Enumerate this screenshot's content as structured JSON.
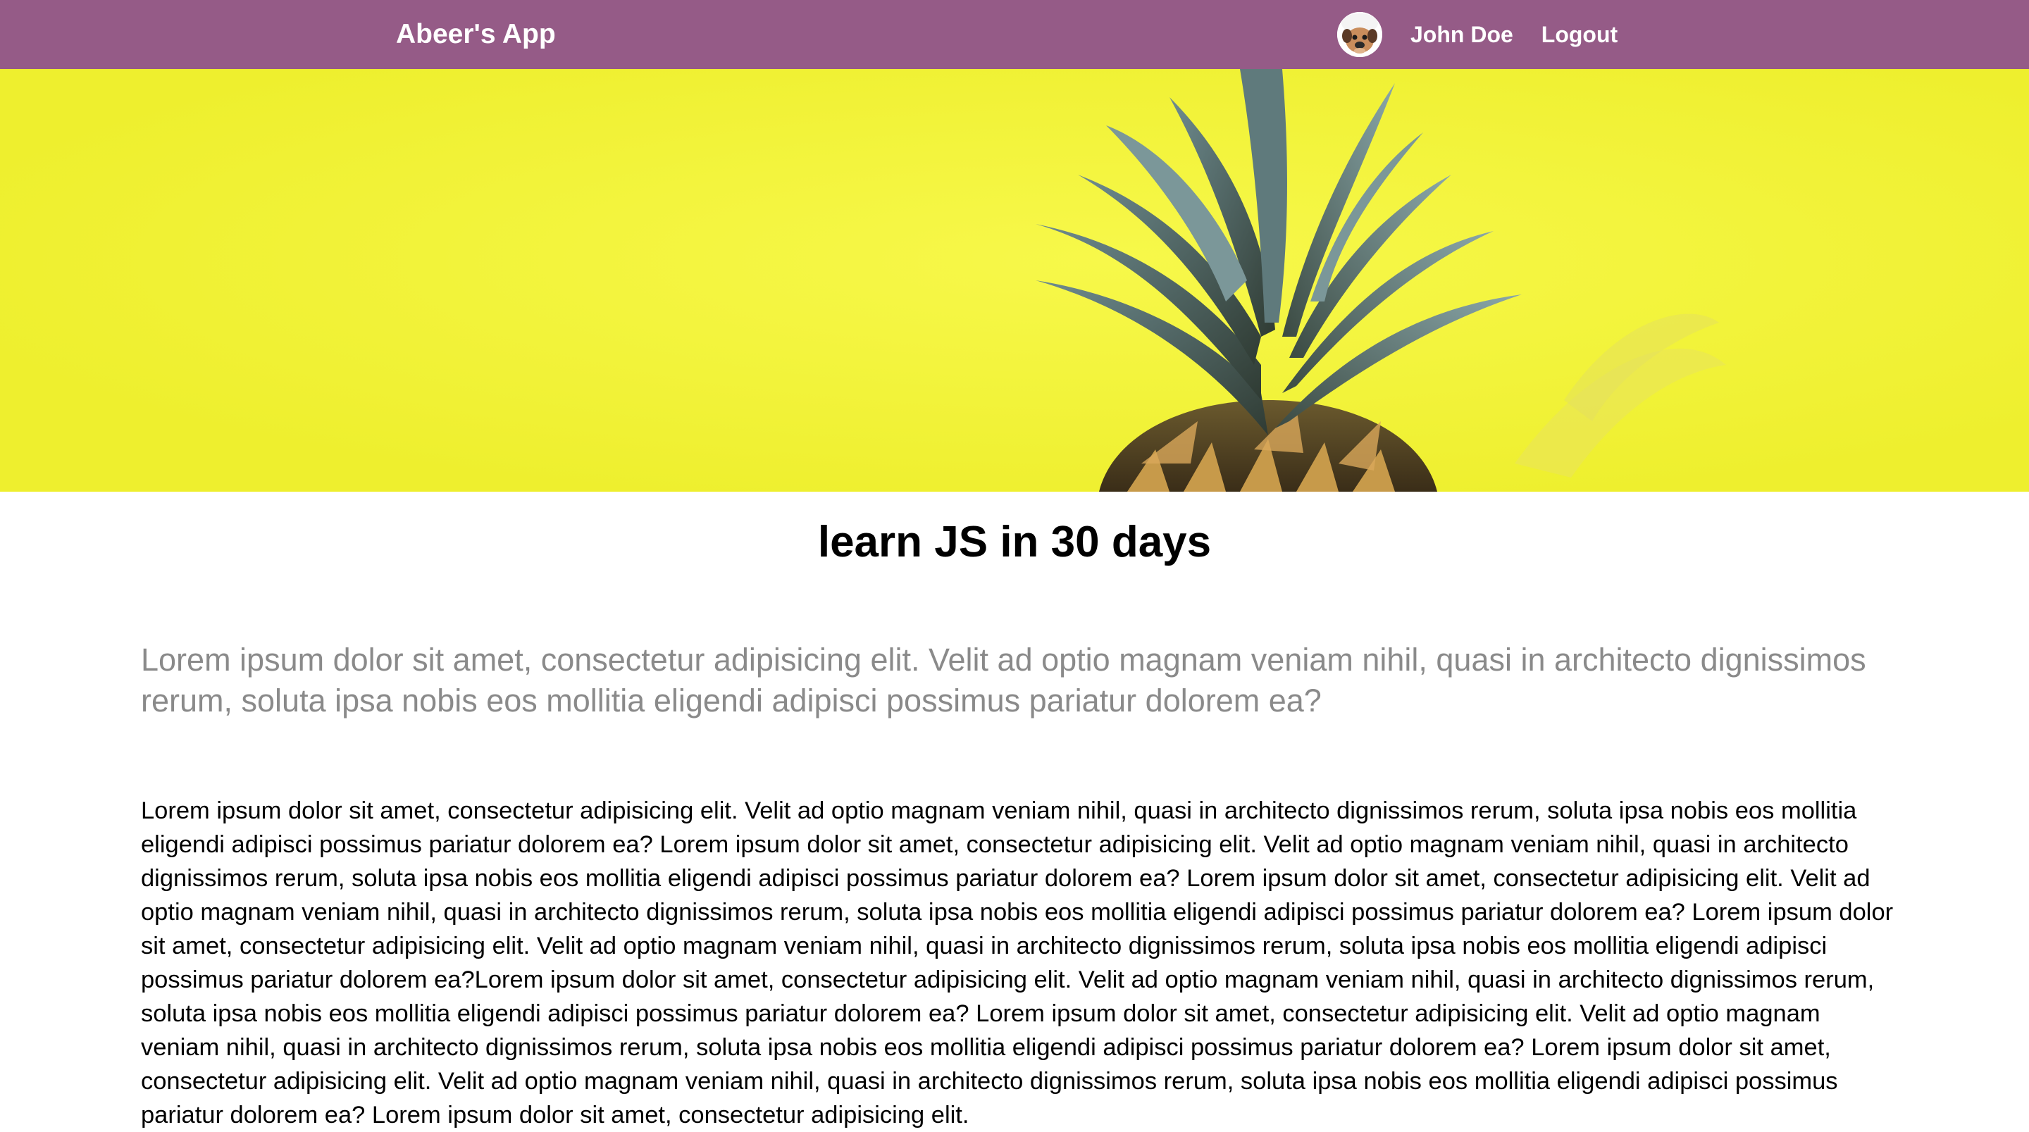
{
  "navbar": {
    "brand": "Abeer's App",
    "user_name": "John Doe",
    "logout_label": "Logout",
    "background": "#955b87"
  },
  "hero": {
    "background": "#f2f339",
    "subject": "pineapple-crown"
  },
  "article": {
    "title": "learn JS in 30 days",
    "lead": "Lorem ipsum dolor sit amet, consectetur adipisicing elit. Velit ad optio magnam veniam nihil, quasi in architecto dignissimos rerum, soluta ipsa nobis eos mollitia eligendi adipisci possimus pariatur dolorem ea?",
    "body": "Lorem ipsum dolor sit amet, consectetur adipisicing elit. Velit ad optio magnam veniam nihil, quasi in architecto dignissimos rerum, soluta ipsa nobis eos mollitia eligendi adipisci possimus pariatur dolorem ea? Lorem ipsum dolor sit amet, consectetur adipisicing elit. Velit ad optio magnam veniam nihil, quasi in architecto dignissimos rerum, soluta ipsa nobis eos mollitia eligendi adipisci possimus pariatur dolorem ea? Lorem ipsum dolor sit amet, consectetur adipisicing elit. Velit ad optio magnam veniam nihil, quasi in architecto dignissimos rerum, soluta ipsa nobis eos mollitia eligendi adipisci possimus pariatur dolorem ea? Lorem ipsum dolor sit amet, consectetur adipisicing elit. Velit ad optio magnam veniam nihil, quasi in architecto dignissimos rerum, soluta ipsa nobis eos mollitia eligendi adipisci possimus pariatur dolorem ea?Lorem ipsum dolor sit amet, consectetur adipisicing elit. Velit ad optio magnam veniam nihil, quasi in architecto dignissimos rerum, soluta ipsa nobis eos mollitia eligendi adipisci possimus pariatur dolorem ea? Lorem ipsum dolor sit amet, consectetur adipisicing elit. Velit ad optio magnam veniam nihil, quasi in architecto dignissimos rerum, soluta ipsa nobis eos mollitia eligendi adipisci possimus pariatur dolorem ea? Lorem ipsum dolor sit amet, consectetur adipisicing elit. Velit ad optio magnam veniam nihil, quasi in architecto dignissimos rerum, soluta ipsa nobis eos mollitia eligendi adipisci possimus pariatur dolorem ea? Lorem ipsum dolor sit amet, consectetur adipisicing elit."
  }
}
